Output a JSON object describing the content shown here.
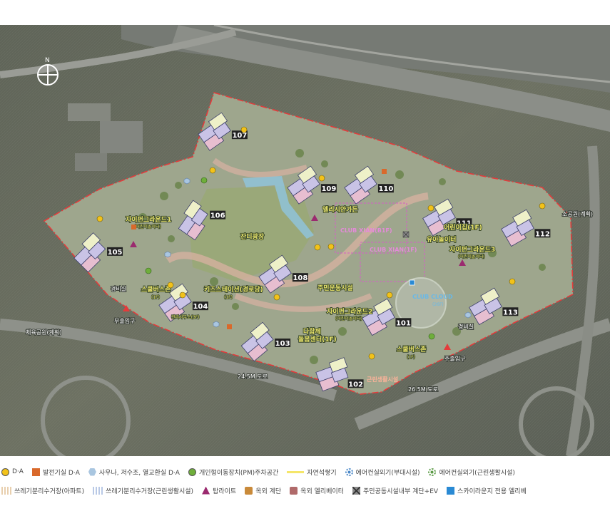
{
  "map": {
    "compass": "N",
    "buildings": [
      "107",
      "109",
      "110",
      "111",
      "112",
      "106",
      "105",
      "108",
      "104",
      "113",
      "103",
      "101",
      "102"
    ],
    "facility_labels": {
      "xi_greenyard1": "자이펀그라운드1",
      "xi_greenyard1_sub": "(어린이놀이터)",
      "elisian_garden": "엘리시안가든",
      "central_plaza": "잔디광장",
      "club_xian_b1": "CLUB XIAN(B1F)",
      "club_xian_1": "CLUB XIAN(1F)",
      "daycare": "어린이집(1F)",
      "nursery": "유아놀이터",
      "xi_greenyard3": "자이펀그라운드3",
      "xi_greenyard3_sub": "(어린이놀이터)",
      "resident_sports": "주민운동시설",
      "school_bus_1": "스쿨버스존",
      "school_bus_1_floor": "(1F)",
      "library": "키즈스테이션(경로당)",
      "library_floor": "(1F)",
      "management": "관리사무소(3F)",
      "xi_greenyard2": "자이펀그라운드2",
      "xi_greenyard2_sub": "(어린이놀이터)",
      "club_cloud": "CLUB CLOUD",
      "club_cloud_floor": "(26F)",
      "senior_center": "다함께",
      "senior_center2": "돌봄센터(1F)",
      "school_bus_2": "스쿨버스존",
      "school_bus_2_floor": "(1F)",
      "neighborhood": "근린생활시설",
      "small_park": "소공원(계획)",
      "sports_park": "체육공원(계획)",
      "guard1": "경비실",
      "guard2": "경비실",
      "sub_gate": "부출입구",
      "main_gate": "주출입구",
      "road1": "24.5M 도로",
      "road2": "26.5M 도로"
    }
  },
  "legend": {
    "row1": [
      {
        "icon": "yellow-circle",
        "label": "D·A",
        "color": "#f2c21a"
      },
      {
        "icon": "orange-square",
        "label": "발전기실 D·A",
        "color": "#d9692b"
      },
      {
        "icon": "blue-hexagon",
        "label": "사우나, 저수조, 열교환실 D·A",
        "color": "#a9c6e0"
      },
      {
        "icon": "green-circle",
        "label": "개인형이동장치(PM)주차공간",
        "color": "#6fae3b"
      },
      {
        "icon": "yellow-line",
        "label": "자연석쌓기",
        "color": "#f5e66a"
      },
      {
        "icon": "blue-fan",
        "label": "에어컨실외기(부대시설)",
        "color": "#4a88c8"
      },
      {
        "icon": "green-fan",
        "label": "에어컨실외기(근린생활시설)",
        "color": "#5a9a45"
      }
    ],
    "row2": [
      {
        "icon": "beige-hatch",
        "label": "쓰레기분리수거장(아파트)",
        "color": "#e8cfae"
      },
      {
        "icon": "blue-hatch",
        "label": "쓰레기분리수거장(근린생활시설)",
        "color": "#b9c9e6"
      },
      {
        "icon": "purple-triangle",
        "label": "탑라이트",
        "color": "#9b2a6f"
      },
      {
        "icon": "stairs-icon",
        "label": "옥외 계단",
        "color": "#c98a3a"
      },
      {
        "icon": "elevator-icon",
        "label": "옥외 엘리베이터",
        "color": "#b06a6a"
      },
      {
        "icon": "cross-box-icon",
        "label": "주민공동시설내부 계단+EV",
        "color": "#8a8a8a"
      },
      {
        "icon": "blue-square",
        "label": "스카이라운지 전용 엘리베",
        "color": "#2a8ad4"
      }
    ]
  }
}
